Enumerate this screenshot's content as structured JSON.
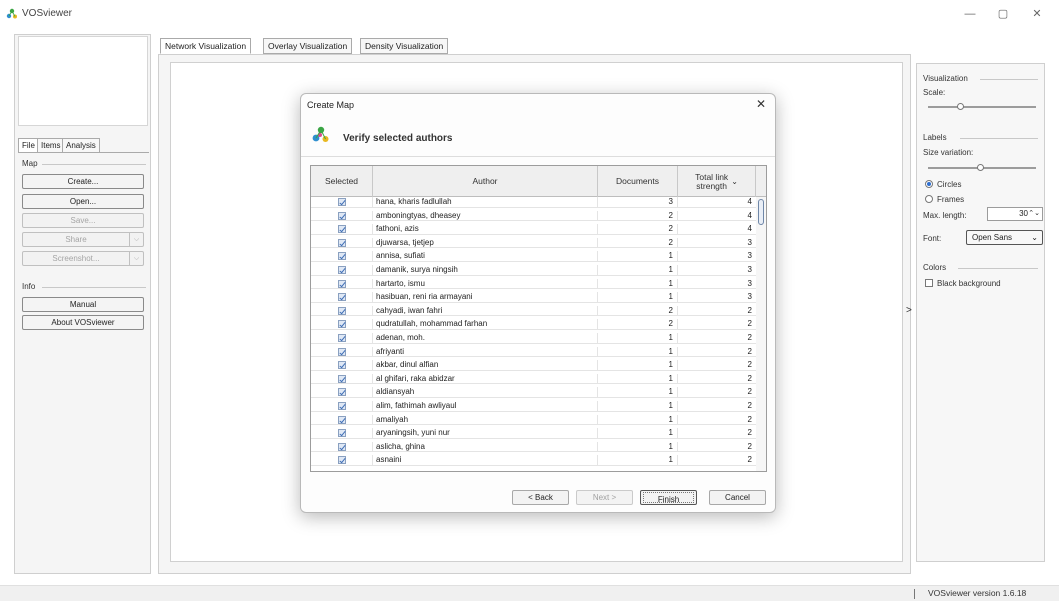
{
  "window": {
    "title": "VOSviewer",
    "minimize": "—",
    "restore": "▢",
    "close": "✕"
  },
  "left_panel": {
    "tabs": [
      "File",
      "Items",
      "Analysis"
    ],
    "map_group": "Map",
    "buttons": {
      "create": "Create...",
      "open": "Open...",
      "save": "Save...",
      "share": "Share",
      "screenshot": "Screenshot..."
    },
    "info_group": "Info",
    "info_buttons": {
      "manual": "Manual",
      "about": "About VOSviewer"
    },
    "split_arrow": "⌵"
  },
  "top_tabs": [
    "Network Visualization",
    "Overlay Visualization",
    "Density Visualization"
  ],
  "right_panel": {
    "visualization": "Visualization",
    "scale": "Scale:",
    "labels": "Labels",
    "size_variation": "Size variation:",
    "circles": "Circles",
    "frames": "Frames",
    "max_length_label": "Max. length:",
    "max_length_value": "30",
    "spin_arrows": "⌃⌄",
    "font_label": "Font:",
    "font_value": "Open Sans",
    "font_caret": "⌄",
    "colors": "Colors",
    "black_background": "Black background",
    "expand_arrow": ">"
  },
  "status": {
    "version": "VOSviewer version 1.6.18"
  },
  "dialog": {
    "title": "Create Map",
    "close": "✕",
    "heading": "Verify selected authors",
    "columns": {
      "selected": "Selected",
      "author": "Author",
      "documents": "Documents",
      "tls_line1": "Total link",
      "tls_line2": "strength",
      "sort": "⌄"
    },
    "rows": [
      {
        "author": "hana, kharis fadlullah",
        "documents": "3",
        "tls": "4"
      },
      {
        "author": "amboningtyas, dheasey",
        "documents": "2",
        "tls": "4"
      },
      {
        "author": "fathoni, azis",
        "documents": "2",
        "tls": "4"
      },
      {
        "author": "djuwarsa, tjetjep",
        "documents": "2",
        "tls": "3"
      },
      {
        "author": "annisa, sufiati",
        "documents": "1",
        "tls": "3"
      },
      {
        "author": "damanik, surya ningsih",
        "documents": "1",
        "tls": "3"
      },
      {
        "author": "hartarto, ismu",
        "documents": "1",
        "tls": "3"
      },
      {
        "author": "hasibuan, reni ria armayani",
        "documents": "1",
        "tls": "3"
      },
      {
        "author": "cahyadi, iwan fahri",
        "documents": "2",
        "tls": "2"
      },
      {
        "author": "qudratullah, mohammad farhan",
        "documents": "2",
        "tls": "2"
      },
      {
        "author": "adenan, moh.",
        "documents": "1",
        "tls": "2"
      },
      {
        "author": "afriyanti",
        "documents": "1",
        "tls": "2"
      },
      {
        "author": "akbar, dinul alfian",
        "documents": "1",
        "tls": "2"
      },
      {
        "author": "al ghifari, raka abidzar",
        "documents": "1",
        "tls": "2"
      },
      {
        "author": "aldiansyah",
        "documents": "1",
        "tls": "2"
      },
      {
        "author": "alim, fathimah awliyaul",
        "documents": "1",
        "tls": "2"
      },
      {
        "author": "amaliyah",
        "documents": "1",
        "tls": "2"
      },
      {
        "author": "aryaningsih, yuni nur",
        "documents": "1",
        "tls": "2"
      },
      {
        "author": "aslicha, ghina",
        "documents": "1",
        "tls": "2"
      },
      {
        "author": "asnaini",
        "documents": "1",
        "tls": "2"
      }
    ],
    "buttons": {
      "back": "< Back",
      "next": "Next >",
      "finish": "Finish",
      "cancel": "Cancel"
    }
  }
}
